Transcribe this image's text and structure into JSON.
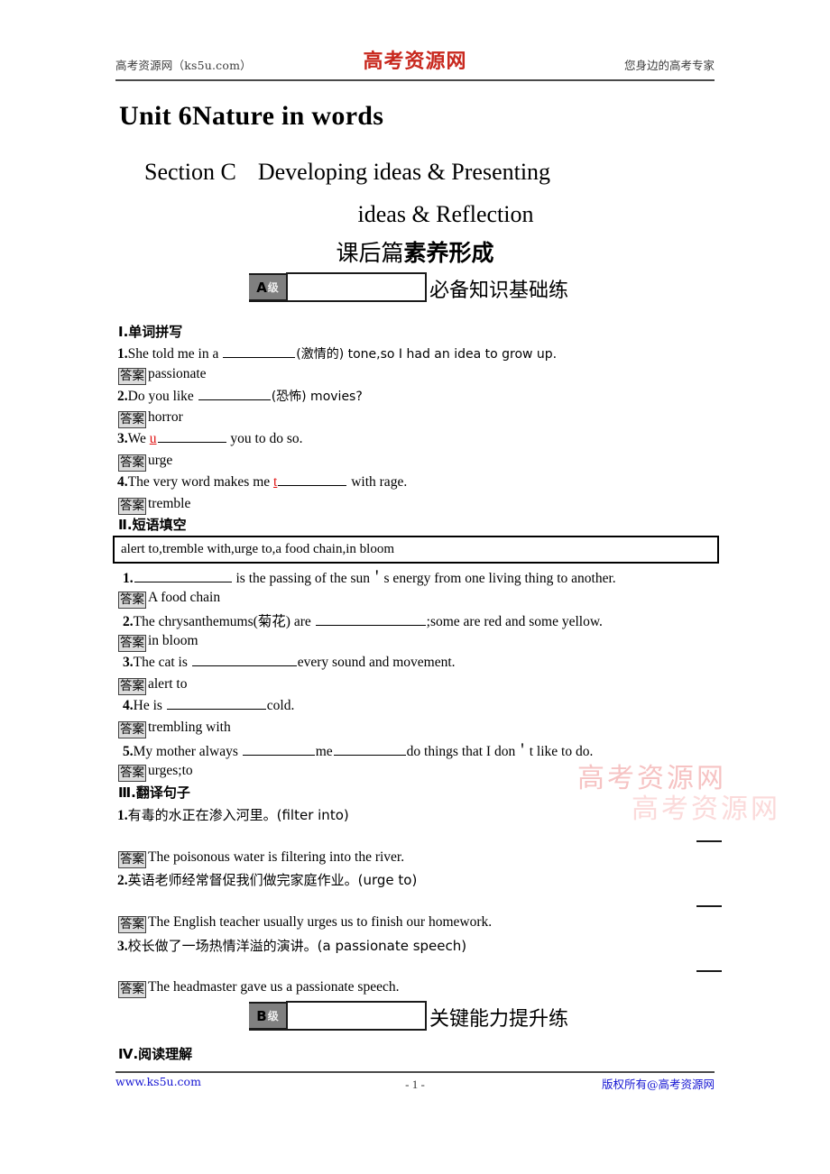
{
  "header": {
    "left": "高考资源网（ks5u.com）",
    "logo": "高考资源网",
    "right": "您身边的高考专家"
  },
  "title": {
    "unit": "Unit 6Nature in words",
    "section_line1_label": "Section C",
    "section_line1_text": "Developing ideas & Presenting",
    "section_line2_text": "ideas & Reflection",
    "cn_title_thin": "课后篇",
    "cn_title_bold": "素养形成"
  },
  "level_a": {
    "badge_letter": "A",
    "badge_sub": "级",
    "label": "必备知识基础练"
  },
  "level_b": {
    "badge_letter": "B",
    "badge_sub": "级",
    "label": "关键能力提升练"
  },
  "section1": {
    "heading": "Ⅰ.单词拼写",
    "items": [
      {
        "num": "1.",
        "pre": "She told me in a ",
        "hint": "",
        "post_paren": "(激情的) tone,so I had an idea to grow up.",
        "answer": "passionate"
      },
      {
        "num": "2.",
        "pre": "Do you like ",
        "hint": "",
        "post_paren": "(恐怖) movies?",
        "answer": "horror"
      },
      {
        "num": "3.",
        "pre": "We ",
        "hint": "u",
        "post_paren": " you to do so.",
        "answer": "urge"
      },
      {
        "num": "4.",
        "pre": "The very word makes me ",
        "hint": "t",
        "post_paren": " with rage.",
        "answer": "tremble"
      }
    ]
  },
  "section2": {
    "heading": "Ⅱ.短语填空",
    "word_bank": "alert to,tremble with,urge to,a food chain,in bloom",
    "items": [
      {
        "num": "1.",
        "pre": "",
        "post": " is the passing of the sun＇s energy from one living thing to another.",
        "answer": "A food chain"
      },
      {
        "num": "2.",
        "pre": "The chrysanthemums(菊花) are ",
        "post": ";some are red and some yellow.",
        "answer": "in bloom"
      },
      {
        "num": "3.",
        "pre": "The cat is ",
        "post": "every sound and movement.",
        "answer": "alert to"
      },
      {
        "num": "4.",
        "pre": "He is ",
        "post": "cold.",
        "answer": "trembling with"
      },
      {
        "num": "5.",
        "pre": "My mother always ",
        "mid": "me",
        "post": "do things that I don＇t like to do.",
        "answer": "urges;to"
      }
    ]
  },
  "section3": {
    "heading": "Ⅲ.翻译句子",
    "items": [
      {
        "num": "1.",
        "prompt": "有毒的水正在渗入河里。(filter into)",
        "answer": "The poisonous water is filtering into the river."
      },
      {
        "num": "2.",
        "prompt": "英语老师经常督促我们做完家庭作业。(urge to)",
        "answer": "The English teacher usually urges us to finish our homework."
      },
      {
        "num": "3.",
        "prompt": "校长做了一场热情洋溢的演讲。(a passionate speech)",
        "answer": "The headmaster gave us a passionate speech."
      }
    ]
  },
  "section4": {
    "heading": "Ⅳ.阅读理解"
  },
  "answer_badge_label": "答案",
  "watermark": {
    "text_1": "高考资源网",
    "text_2": "高考资源网"
  },
  "footer": {
    "left": "www.ks5u.com",
    "center": "- 1 -",
    "right": "版权所有@高考资源网"
  }
}
